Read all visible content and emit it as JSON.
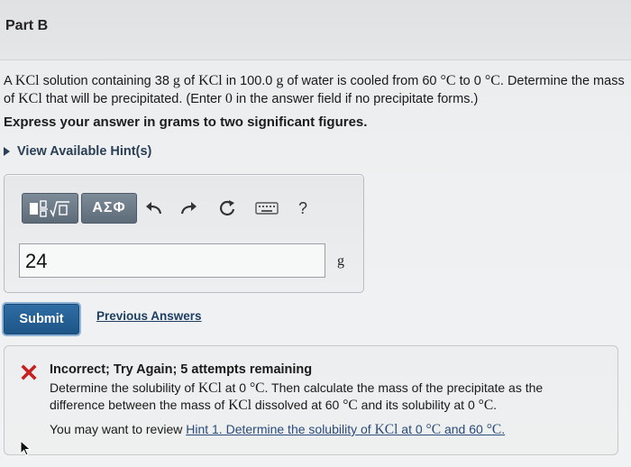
{
  "part": {
    "title": "Part B"
  },
  "problem": {
    "t1": "A ",
    "m1": "KCl",
    "t2": " solution containing 38 ",
    "m2": "g",
    "t3": " of ",
    "m3": "KCl",
    "t4": " in 100.0 ",
    "m4": "g",
    "t5": " of water is cooled from 60 ",
    "m5": "°C",
    "t6": " to 0 ",
    "m6": "°C",
    "t7": ". Determine the mass of ",
    "m7": "KCl",
    "t8": " that will be precipitated. (Enter ",
    "m8": "0",
    "t9": " in the answer field if no precipitate forms.)"
  },
  "instruction": "Express your answer in grams to two significant figures.",
  "hints_label": "View Available Hint(s)",
  "toolbar": {
    "greek_label": "ΑΣΦ",
    "help_label": "?"
  },
  "answer": {
    "value": "24",
    "unit": "g"
  },
  "submit_label": "Submit",
  "previous_answers_label": "Previous Answers",
  "feedback": {
    "title": "Incorrect; Try Again; 5 attempts remaining",
    "b1": "Determine the solubility of ",
    "bm1": "KCl",
    "b2": " at 0 ",
    "bm2": "°C",
    "b3": ". Then calculate the mass of the precipitate as the difference between the mass of ",
    "bm3": "KCl",
    "b4": " dissolved at 60 ",
    "bm4": "°C",
    "b5": " and its solubility at 0 ",
    "bm5": "°C",
    "b6": ".",
    "review_prefix": "You may want to review ",
    "hint_text": "Hint 1. Determine the solubility of ",
    "hint_m1": "KCl",
    "hint_t2": " at 0 ",
    "hint_m2": "°C",
    "hint_t3": " and 60 ",
    "hint_m3": "°C",
    "hint_t4": "."
  },
  "colors": {
    "submit": "#1e5587",
    "error": "#c8201e",
    "link": "#1d3f63"
  }
}
